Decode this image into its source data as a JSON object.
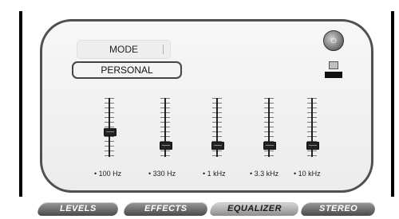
{
  "mode": {
    "label": "MODE",
    "preset": "PERSONAL"
  },
  "equalizer": {
    "bands": [
      {
        "label": "• 100 Hz",
        "level": 0.43
      },
      {
        "label": "• 330 Hz",
        "level": 0.17
      },
      {
        "label": "• 1 kHz",
        "level": 0.17
      },
      {
        "label": "• 3.3 kHz",
        "level": 0.17
      },
      {
        "label": "• 10 kHz",
        "level": 0.17
      }
    ]
  },
  "tabs": [
    {
      "label": "LEVELS"
    },
    {
      "label": "EFFECTS"
    },
    {
      "label": "EQUALIZER",
      "active": true
    },
    {
      "label": "STEREO"
    }
  ],
  "icons": {
    "power": "power-knob-icon",
    "save": "save-preset-icon"
  }
}
